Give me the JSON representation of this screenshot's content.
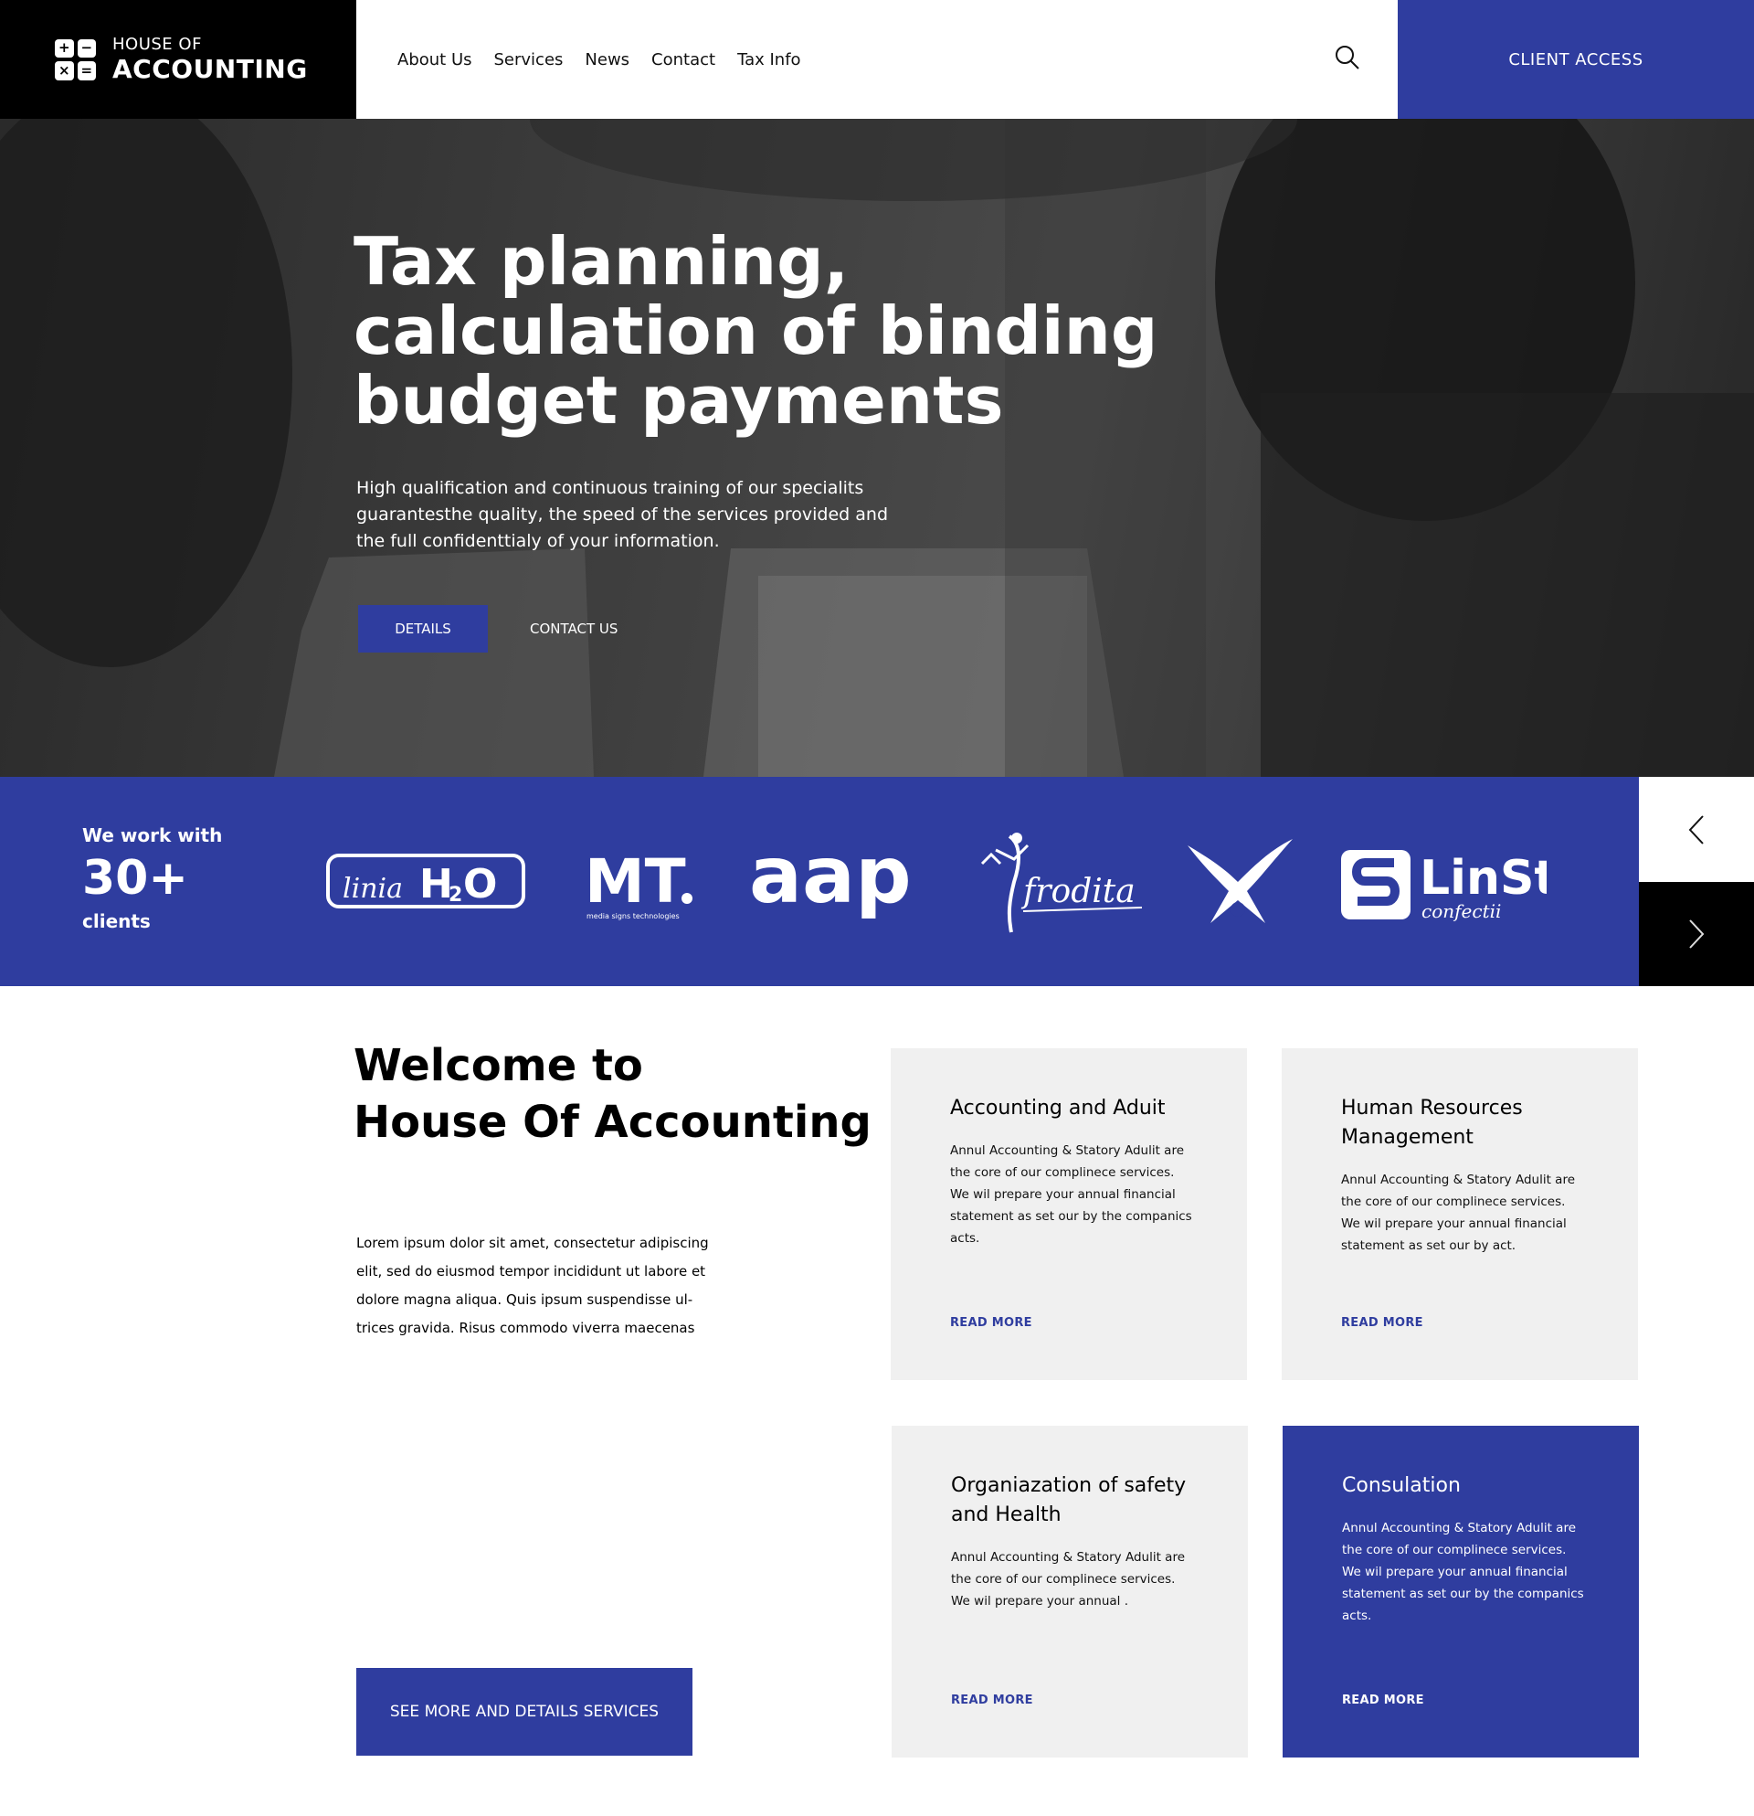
{
  "brand": {
    "top": "HOUSE OF",
    "bottom": "ACCOUNTING"
  },
  "nav": [
    "About Us",
    "Services",
    "News",
    "Contact",
    "Tax Info"
  ],
  "header": {
    "client_access": "CLIENT ACCESS",
    "search_icon": "search-icon"
  },
  "hero": {
    "title_lines": [
      "Tax planning,",
      "calculation of binding",
      "budget payments"
    ],
    "subtitle": "High qualification and continuous training of our specialits guarantesthe quality, the speed of the services provided and the full confidenttialy of your information.",
    "details_label": "DETAILS",
    "contact_label": "CONTACT US"
  },
  "clients": {
    "lead": "We work with",
    "count": "30+",
    "tail": "clients",
    "logos": [
      "liniaH2O",
      "MT media signs technologies",
      "aap",
      "Afrodita",
      "bird emblem",
      "LinStil confectii"
    ]
  },
  "welcome": {
    "title_lines": [
      "Welcome to",
      "House Of Accounting"
    ],
    "text": "Lorem ipsum dolor sit amet, consectetur adipiscing elit, sed do eiusmod tempor incididunt ut labore et dolore magna aliqua. Quis ipsum suspendisse ul-trices gravida. Risus commodo viverra maecenas",
    "see_more": "SEE MORE AND DETAILS SERVICES"
  },
  "services": [
    {
      "title": "Accounting and Aduit",
      "desc": "Annul Accounting & Statory Adulit are the core of our complinece services. We wil prepare your annual financial statement as set our by the companics acts.",
      "link": "READ MORE"
    },
    {
      "title": "Human Resources Management",
      "desc": "Annul Accounting & Statory Adulit are the core of our complinece services. We wil prepare your annual financial statement as set our by act.",
      "link": "READ MORE"
    },
    {
      "title": "Organiazation of safety and Health",
      "desc": "Annul Accounting & Statory Adulit are the core of our complinece services. We wil prepare your annual .",
      "link": "READ MORE"
    },
    {
      "title": "Consulation",
      "desc": "Annul Accounting & Statory Adulit are the core of our complinece services. We wil prepare your annual financial statement as set our by the companics acts.",
      "link": "READ MORE"
    }
  ],
  "colors": {
    "accent": "#2f3d9f",
    "dark": "#000000",
    "card_bg": "#f0f0f0"
  }
}
